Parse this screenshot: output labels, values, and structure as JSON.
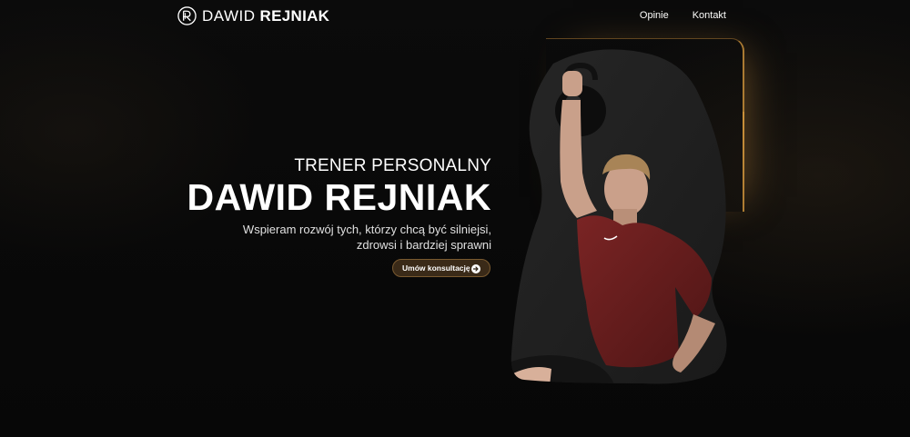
{
  "brand": {
    "first_name": "DAWID",
    "last_name": "REJNIAK",
    "mark_icon": "dr-monogram-icon"
  },
  "nav": {
    "items": [
      {
        "label": "Opinie"
      },
      {
        "label": "Kontakt"
      }
    ]
  },
  "hero": {
    "subtitle": "TRENER PERSONALNY",
    "title": "DAWID REJNIAK",
    "description": "Wspieram rozwój tych, którzy chcą być silniejsi, zdrowsi i bardziej sprawni",
    "cta_label": "Umów konsultację",
    "cta_icon": "arrow-right-circle-icon",
    "image": "trainer-with-kettlebell-photo"
  },
  "colors": {
    "background": "#080808",
    "accent": "#c8913c",
    "cta_fill": "#3a2a18",
    "shirt": "#6e1f1f"
  }
}
